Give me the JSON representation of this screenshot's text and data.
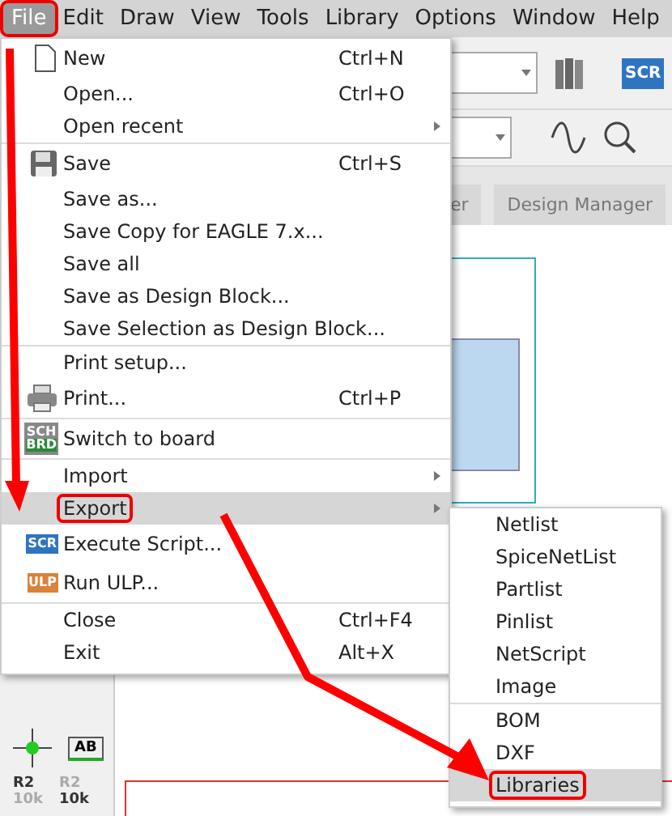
{
  "menu_bar": [
    {
      "label": "File",
      "selected": true,
      "callout": true
    },
    {
      "label": "Edit",
      "selected": false
    },
    {
      "label": "Draw",
      "selected": false
    },
    {
      "label": "View",
      "selected": false
    },
    {
      "label": "Tools",
      "selected": false
    },
    {
      "label": "Library",
      "selected": false
    },
    {
      "label": "Options",
      "selected": false
    },
    {
      "label": "Window",
      "selected": false
    },
    {
      "label": "Help",
      "selected": false
    }
  ],
  "toolbar": {
    "script_badge": "SCR"
  },
  "tabs": [
    {
      "label": "er",
      "selected": false
    },
    {
      "label": "Design Manager",
      "selected": false
    }
  ],
  "file_menu": [
    [
      {
        "label": "New",
        "shortcut": "Ctrl+N",
        "kind": "new"
      },
      {
        "label": "Open...",
        "shortcut": "Ctrl+O"
      },
      {
        "label": "Open recent",
        "submenu": true
      }
    ],
    [
      {
        "label": "Save",
        "shortcut": "Ctrl+S",
        "kind": "save"
      },
      {
        "label": "Save as..."
      },
      {
        "label": "Save Copy for EAGLE 7.x..."
      },
      {
        "label": "Save all"
      },
      {
        "label": "Save as Design Block..."
      },
      {
        "label": "Save Selection as Design Block..."
      }
    ],
    [
      {
        "label": "Print setup..."
      },
      {
        "label": "Print...",
        "shortcut": "Ctrl+P",
        "kind": "print"
      }
    ],
    [
      {
        "label": "Switch to board",
        "kind": "switch",
        "badge": [
          "SCH",
          "BRD"
        ]
      }
    ],
    [
      {
        "label": "Import",
        "submenu": true
      },
      {
        "label": "Export",
        "submenu": true,
        "highlighted": true,
        "callout": true
      },
      {
        "label": "Execute Script...",
        "kind": "script",
        "badge": [
          "SCR"
        ]
      },
      {
        "label": "Run ULP...",
        "kind": "ulp",
        "badge": [
          "ULP"
        ]
      }
    ],
    [
      {
        "label": "Close",
        "shortcut": "Ctrl+F4"
      },
      {
        "label": "Exit",
        "shortcut": "Alt+X"
      }
    ]
  ],
  "export_menu": [
    [
      {
        "label": "Netlist"
      },
      {
        "label": "SpiceNetList"
      },
      {
        "label": "Partlist"
      },
      {
        "label": "Pinlist"
      },
      {
        "label": "NetScript"
      },
      {
        "label": "Image"
      }
    ],
    [
      {
        "label": "BOM"
      },
      {
        "label": "DXF"
      },
      {
        "label": "Libraries",
        "highlighted": true,
        "callout": true
      }
    ]
  ],
  "left_toolbar": {
    "label_tool": "AB",
    "parts": [
      {
        "name": "R2",
        "value": "10k"
      },
      {
        "name": "R2",
        "value": "10k"
      }
    ]
  }
}
